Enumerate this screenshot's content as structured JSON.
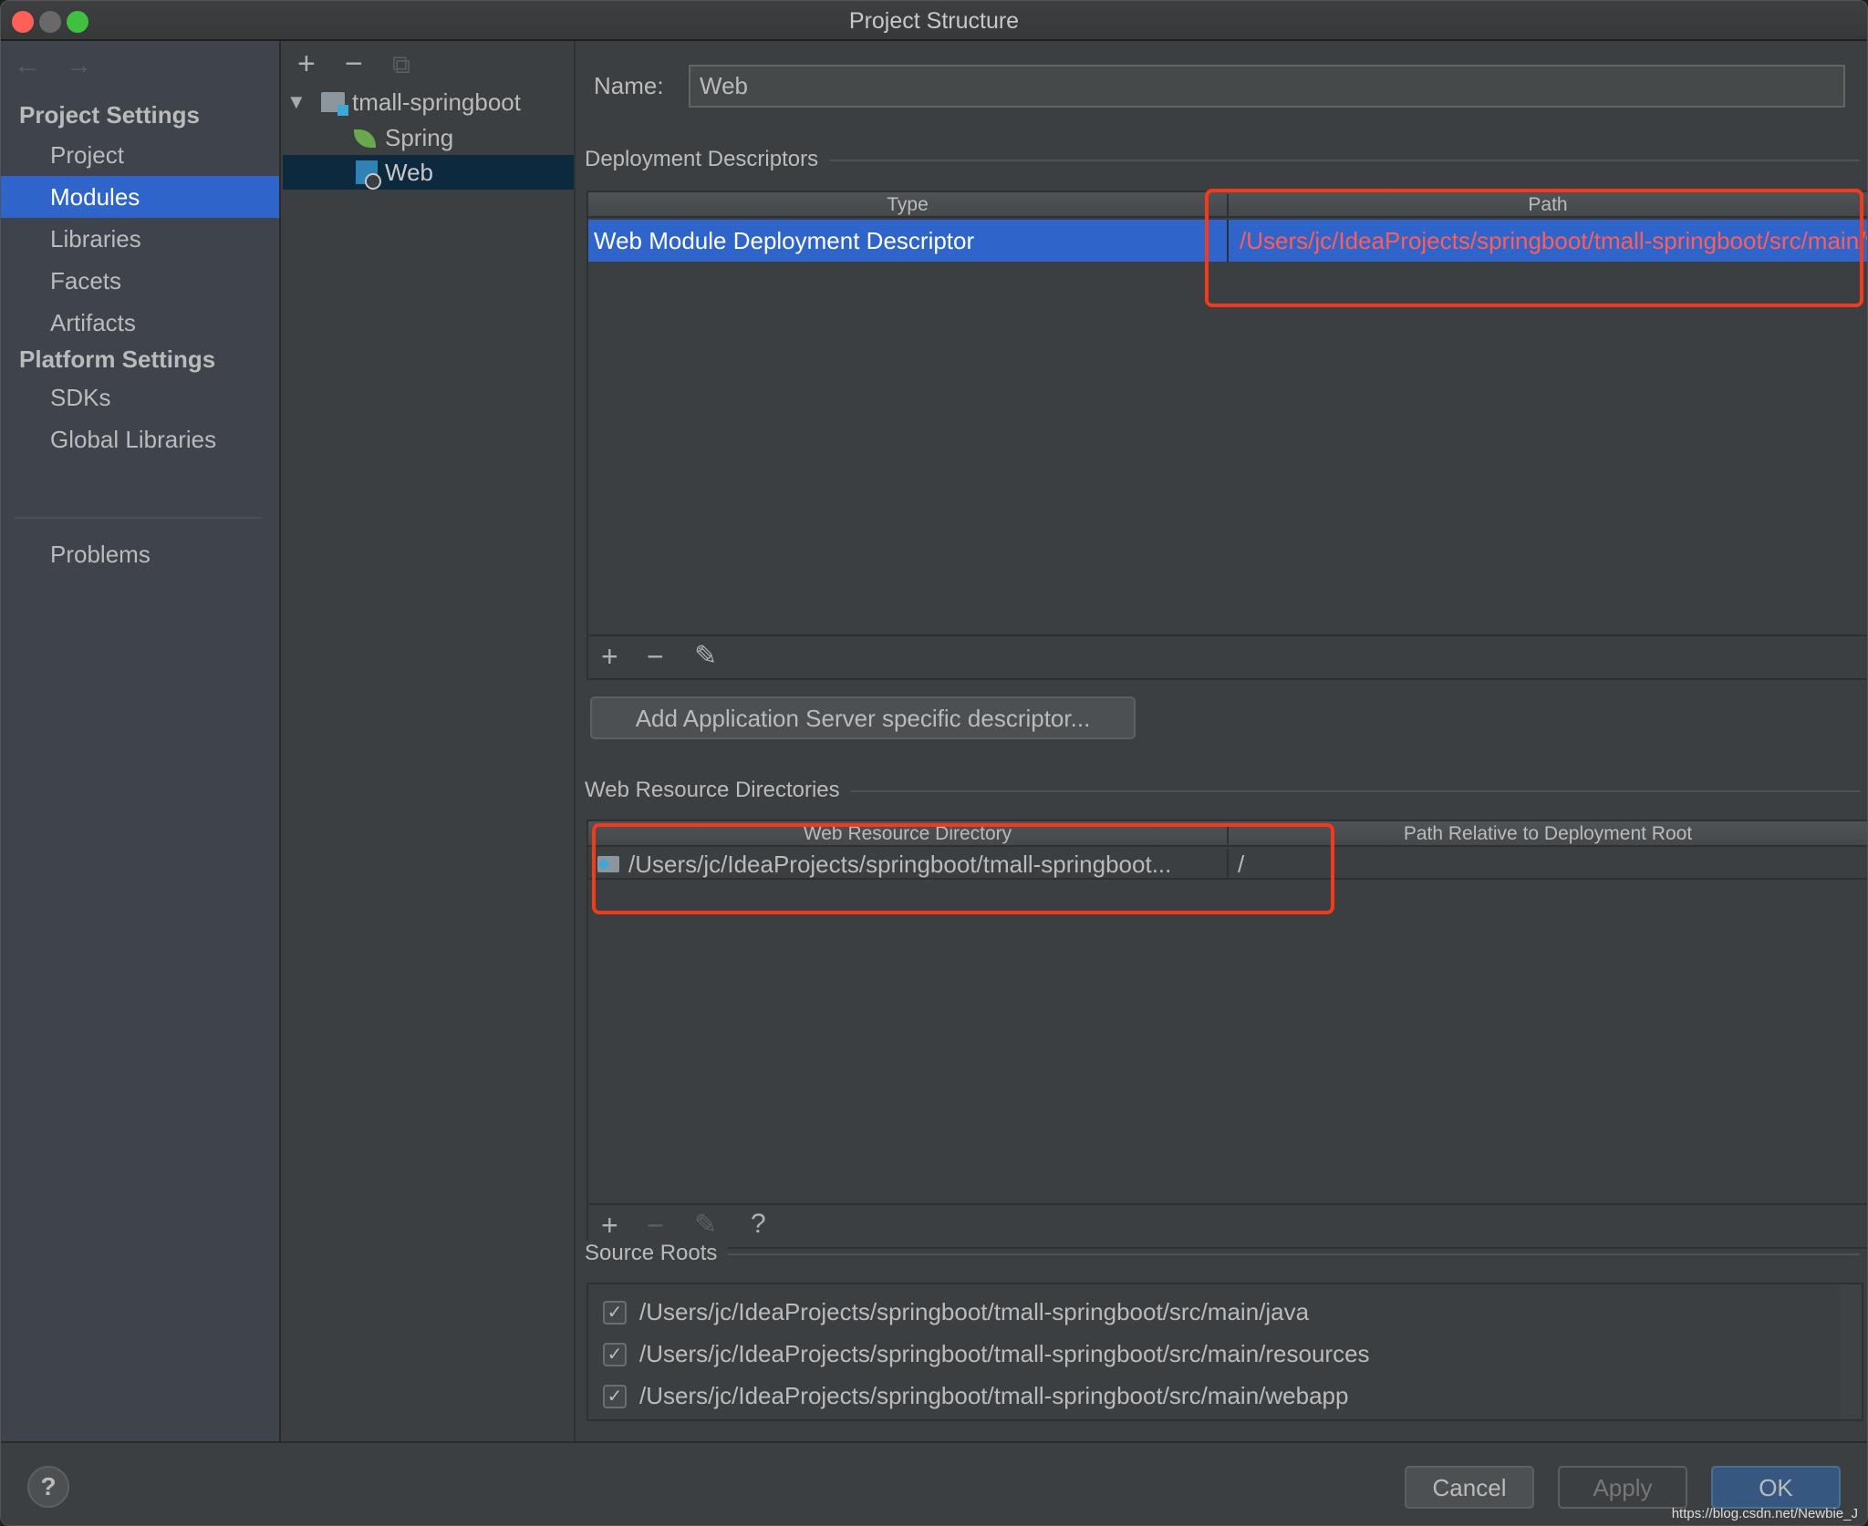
{
  "window": {
    "title": "Project Structure"
  },
  "sidebar": {
    "nav_back": "←",
    "nav_forward": "→",
    "sections": [
      {
        "heading": "Project Settings",
        "items": [
          {
            "label": "Project",
            "active": false
          },
          {
            "label": "Modules",
            "active": true
          },
          {
            "label": "Libraries",
            "active": false
          },
          {
            "label": "Facets",
            "active": false
          },
          {
            "label": "Artifacts",
            "active": false
          }
        ]
      },
      {
        "heading": "Platform Settings",
        "items": [
          {
            "label": "SDKs",
            "active": false
          },
          {
            "label": "Global Libraries",
            "active": false
          }
        ]
      }
    ],
    "problems": "Problems"
  },
  "tree": {
    "tools": {
      "add": "+",
      "remove": "−",
      "copy": "⧉"
    },
    "root": {
      "label": "tmall-springboot",
      "expanded": true
    },
    "children": [
      {
        "label": "Spring",
        "icon": "spring-leaf-icon",
        "selected": false
      },
      {
        "label": "Web",
        "icon": "web-facet-icon",
        "selected": true
      }
    ]
  },
  "main": {
    "name_label": "Name:",
    "name_value": "Web",
    "deployment": {
      "title": "Deployment Descriptors",
      "columns": [
        "Type",
        "Path"
      ],
      "rows": [
        {
          "type": "Web Module Deployment Descriptor",
          "path": "/Users/jc/IdeaProjects/springboot/tmall-springboot/src/main/webapp/WEB-INF/web.xml",
          "selected": true
        }
      ],
      "toolbar": {
        "add": "+",
        "remove": "−",
        "edit": "✎"
      },
      "add_server_button": "Add Application Server specific descriptor..."
    },
    "web_resources": {
      "title": "Web Resource Directories",
      "columns": [
        "Web Resource Directory",
        "Path Relative to Deployment Root"
      ],
      "rows": [
        {
          "directory": "/Users/jc/IdeaProjects/springboot/tmall-springboot...",
          "relative_path": "/"
        }
      ],
      "toolbar": {
        "add": "+",
        "remove": "−",
        "edit": "✎",
        "help": "?"
      }
    },
    "source_roots": {
      "title": "Source Roots",
      "items": [
        {
          "path": "/Users/jc/IdeaProjects/springboot/tmall-springboot/src/main/java",
          "checked": true
        },
        {
          "path": "/Users/jc/IdeaProjects/springboot/tmall-springboot/src/main/resources",
          "checked": true
        },
        {
          "path": "/Users/jc/IdeaProjects/springboot/tmall-springboot/src/main/webapp",
          "checked": true
        }
      ]
    }
  },
  "footer": {
    "help": "?",
    "cancel": "Cancel",
    "apply": "Apply",
    "ok": "OK",
    "watermark": "https://blog.csdn.net/Newbie_J"
  },
  "colors": {
    "selection": "#2f65ca",
    "tree_selection": "#0d293e",
    "invalid_path": "#ff5c5c",
    "annotation_red": "#f23b1c",
    "ok_button": "#365880"
  },
  "checkmark": "✓"
}
